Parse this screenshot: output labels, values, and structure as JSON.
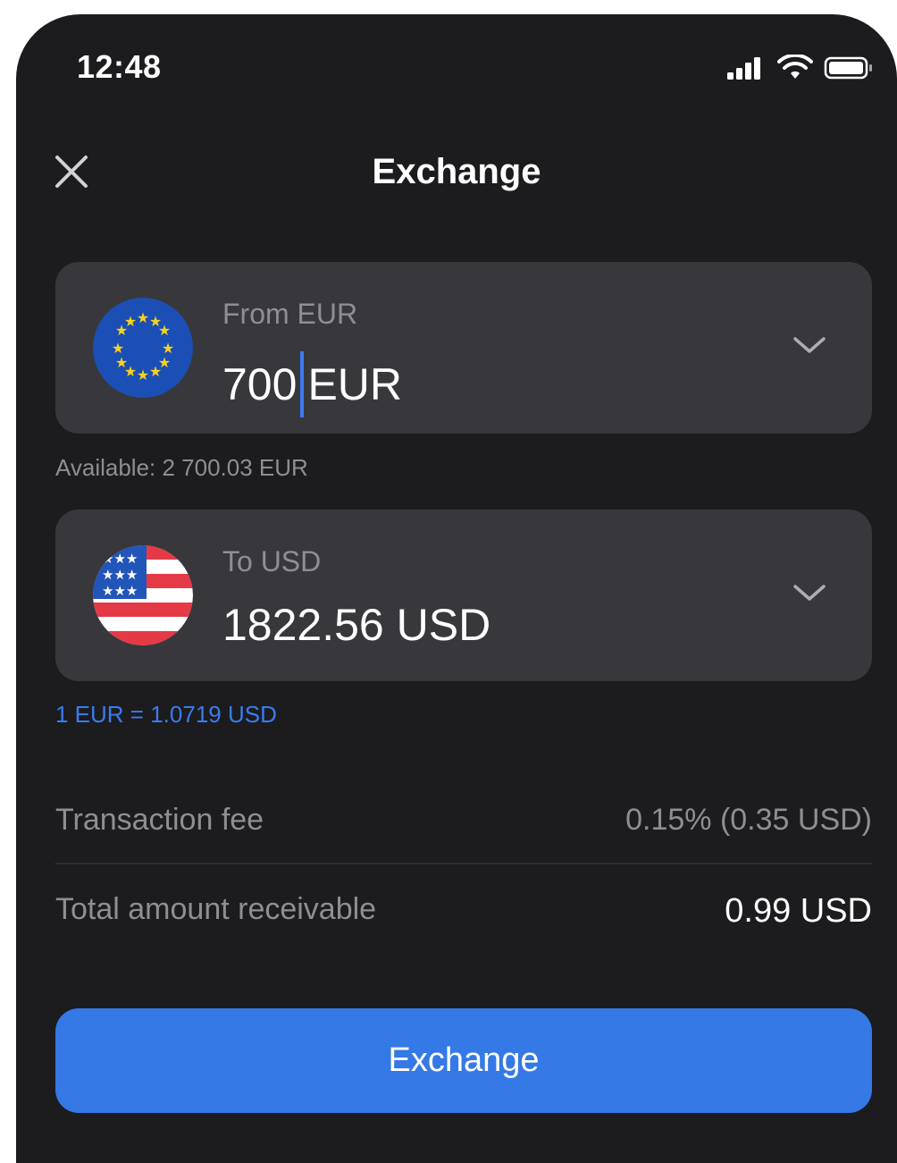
{
  "status_bar": {
    "time": "12:48"
  },
  "header": {
    "title": "Exchange"
  },
  "from": {
    "label": "From EUR",
    "amount": "700",
    "currency": "EUR",
    "flag_icon": "eu-flag-icon"
  },
  "available": "Available: 2 700.03 EUR",
  "to": {
    "label": "To USD",
    "amount": "1822.56 USD",
    "flag_icon": "us-flag-icon"
  },
  "rate": "1 EUR = 1.0719 USD",
  "fee": {
    "label": "Transaction fee",
    "value": "0.15% (0.35 USD)"
  },
  "total": {
    "label": "Total amount receivable",
    "value": "0.99 USD"
  },
  "button": {
    "label": "Exchange"
  },
  "colors": {
    "background": "#1c1c1e",
    "card": "#38383c",
    "accent": "#3479e6",
    "muted": "#8e8e93"
  }
}
